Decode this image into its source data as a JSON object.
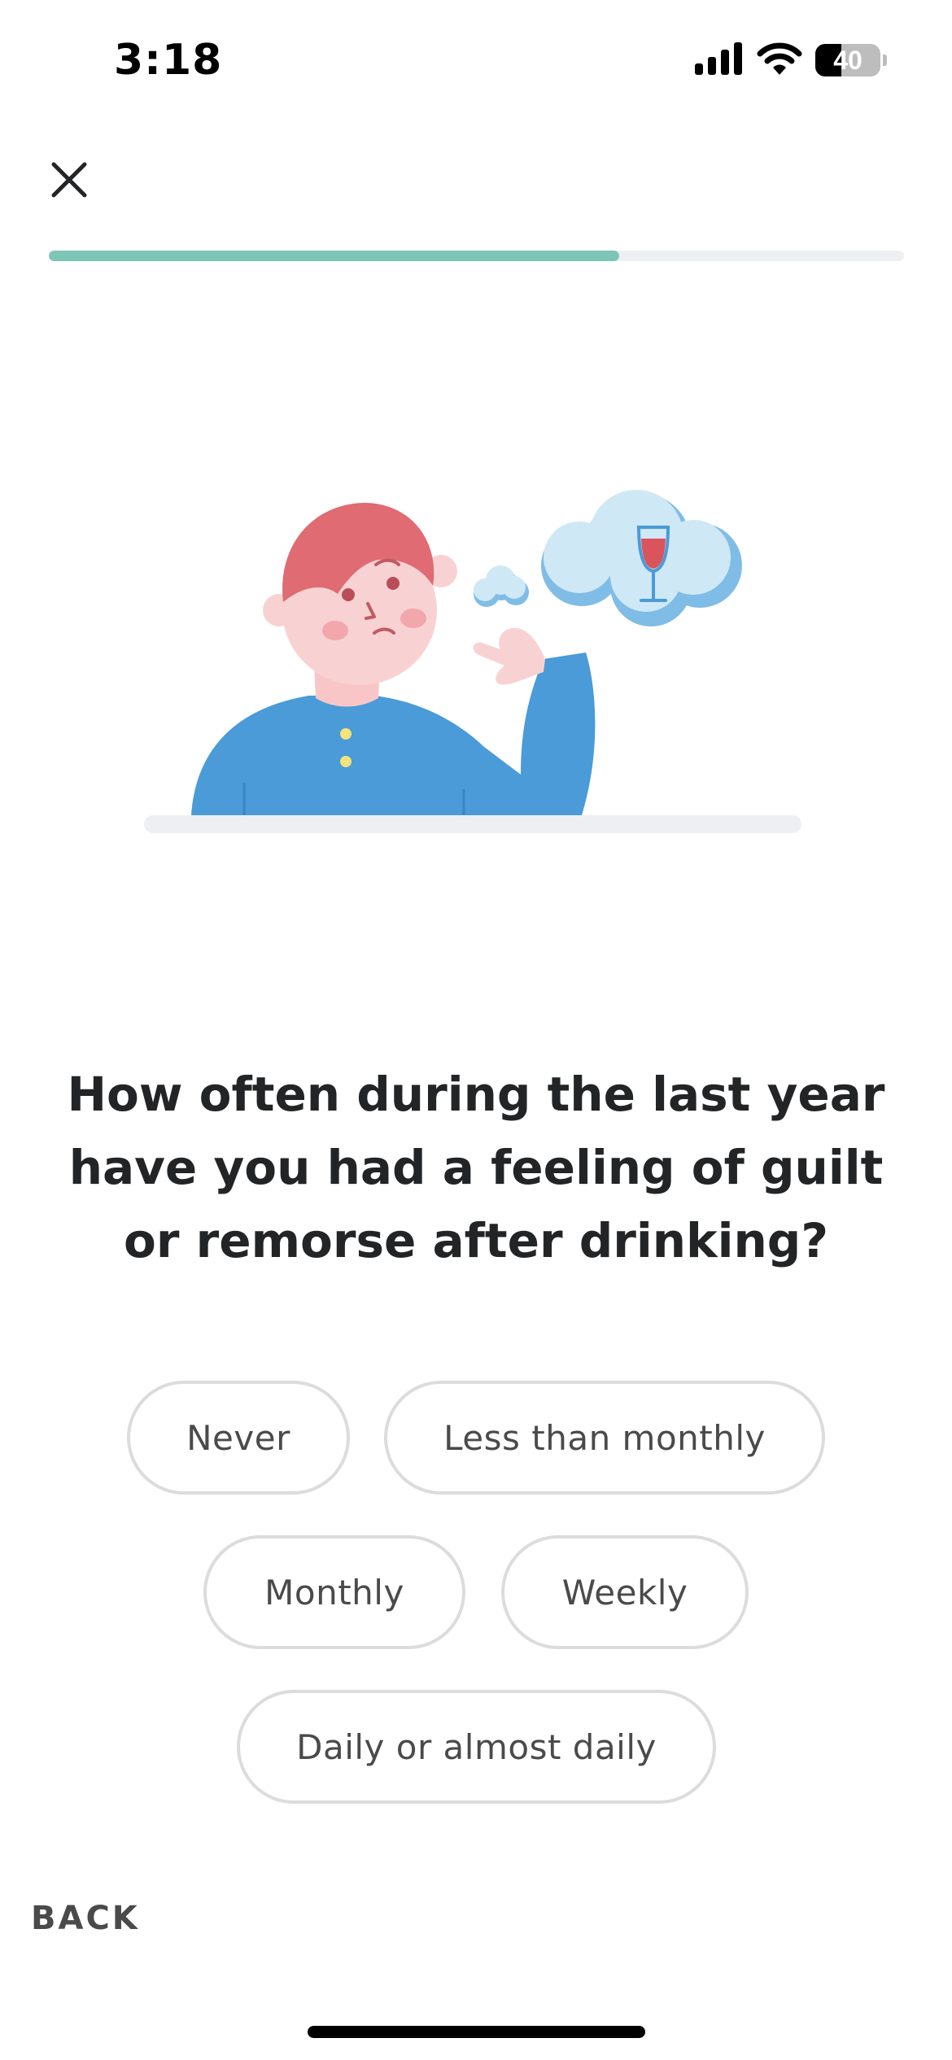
{
  "status_bar": {
    "time": "3:18",
    "battery_level": "40",
    "battery_fraction": 0.4,
    "icons": [
      "cellular-signal-icon",
      "wifi-icon",
      "battery-icon"
    ]
  },
  "header": {
    "close_icon": "close-icon",
    "progress_fraction": 0.667
  },
  "illustration": {
    "name": "worried-person-thinking-of-wine"
  },
  "question": {
    "text": "How often during the last year have you had a feeling of guilt or remorse after drinking?"
  },
  "options": [
    {
      "label": "Never"
    },
    {
      "label": "Less than monthly"
    },
    {
      "label": "Monthly"
    },
    {
      "label": "Weekly"
    },
    {
      "label": "Daily or almost daily"
    }
  ],
  "footer": {
    "back_label": "BACK"
  },
  "colors": {
    "accent": "#7dc5b6",
    "track": "#edeff2",
    "option_border": "#dcdcdc",
    "text_primary": "#222426",
    "text_secondary": "#4a4a4a"
  }
}
